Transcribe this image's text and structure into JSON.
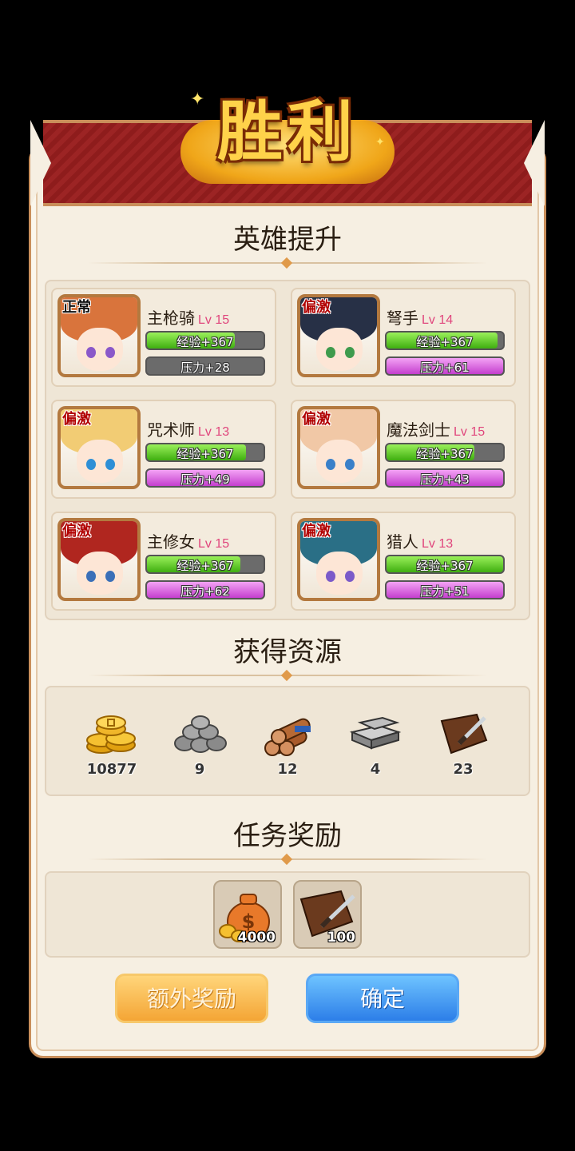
{
  "title": "胜利",
  "sections": {
    "heroes": "英雄提升",
    "resources": "获得资源",
    "quest": "任务奖励"
  },
  "heroes": [
    {
      "name": "主枪骑",
      "lv": "Lv 15",
      "mood": "正常",
      "exp": "经验+367",
      "pressure": "压力+28",
      "exp_fill": 0.75,
      "pressure_fill": 0.0,
      "hair": "#d9743c",
      "eye": "#8a58c9"
    },
    {
      "name": "弩手",
      "lv": "Lv 14",
      "mood": "偏激",
      "exp": "经验+367",
      "pressure": "压力+61",
      "exp_fill": 0.95,
      "pressure_fill": 1.0,
      "hair": "#273046",
      "eye": "#3f9b4d"
    },
    {
      "name": "咒术师",
      "lv": "Lv 13",
      "mood": "偏激",
      "exp": "经验+367",
      "pressure": "压力+49",
      "exp_fill": 0.85,
      "pressure_fill": 1.0,
      "hair": "#f2cc74",
      "eye": "#2e8fd6"
    },
    {
      "name": "魔法剑士",
      "lv": "Lv 15",
      "mood": "偏激",
      "exp": "经验+367",
      "pressure": "压力+43",
      "exp_fill": 0.75,
      "pressure_fill": 1.0,
      "hair": "#f1c8a6",
      "eye": "#3a80c9"
    },
    {
      "name": "主修女",
      "lv": "Lv 15",
      "mood": "偏激",
      "exp": "经验+367",
      "pressure": "压力+62",
      "exp_fill": 0.8,
      "pressure_fill": 1.0,
      "hair": "#b0261f",
      "eye": "#3a6fb8"
    },
    {
      "name": "猎人",
      "lv": "Lv 13",
      "mood": "偏激",
      "exp": "经验+367",
      "pressure": "压力+51",
      "exp_fill": 1.0,
      "pressure_fill": 1.0,
      "hair": "#2a6f86",
      "eye": "#7b5ac9"
    }
  ],
  "resources": [
    {
      "icon": "gold-coins-icon",
      "count": "10877"
    },
    {
      "icon": "stone-pile-icon",
      "count": "9"
    },
    {
      "icon": "wood-logs-icon",
      "count": "12"
    },
    {
      "icon": "iron-ingot-icon",
      "count": "4"
    },
    {
      "icon": "leather-icon",
      "count": "23"
    }
  ],
  "rewards": [
    {
      "icon": "money-bag-icon",
      "qty": "4000"
    },
    {
      "icon": "leather-icon",
      "qty": "100"
    }
  ],
  "buttons": {
    "extra": "额外奖励",
    "confirm": "确定"
  },
  "colors": {
    "exp": "#3fae10",
    "pressure": "#c43fce",
    "level": "#e0457c",
    "mood_agitated": "#b10000"
  }
}
